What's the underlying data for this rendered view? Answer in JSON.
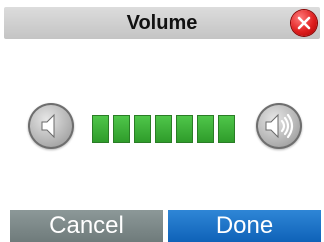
{
  "title": "Volume",
  "icons": {
    "close": "close-icon",
    "volume_down": "speaker-volume-down-icon",
    "volume_up": "speaker-volume-up-icon"
  },
  "volume": {
    "segments_shown": 7,
    "level_color": "#3cb035"
  },
  "buttons": {
    "cancel_label": "Cancel",
    "done_label": "Done"
  },
  "colors": {
    "titlebar": "#cfcfcf",
    "close": "#e02020",
    "cancel": "#7e8a8a",
    "done": "#1a6fc4"
  }
}
